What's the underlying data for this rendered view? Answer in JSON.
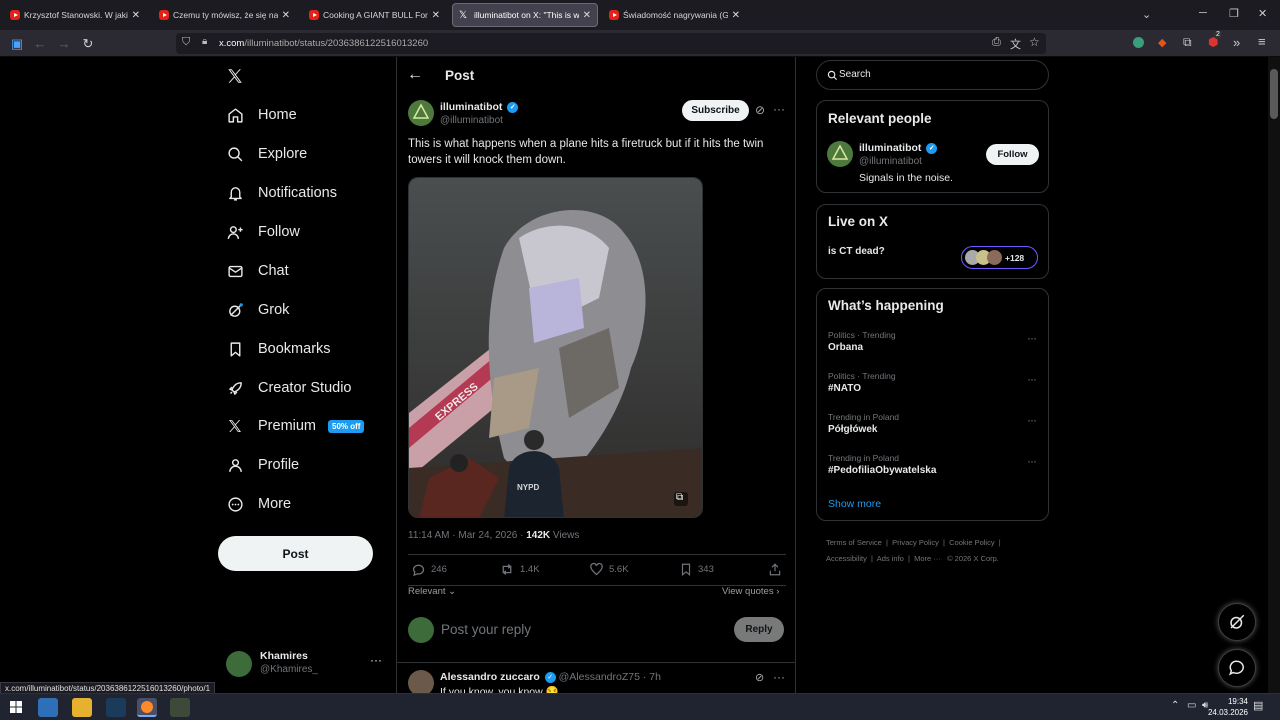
{
  "browser": {
    "tabs": [
      {
        "title": "Krzysztof Stanowski. W jakiej sy",
        "icon": "youtube-icon"
      },
      {
        "title": "Czemu ty mówisz, że się na cie",
        "icon": "youtube-icon"
      },
      {
        "title": "Cooking A GIANT BULL For A G",
        "icon": "youtube-icon"
      },
      {
        "title": "illuminatibot on X: \"This is what",
        "icon": "x-icon"
      },
      {
        "title": "Świadomość nagrywania (Giełd",
        "icon": "youtube-icon"
      }
    ],
    "url_host": "x.com",
    "url_path": "/illuminatibot/status/2036386122516013260",
    "status_url": "x.com/illuminatibot/status/2036386122516013260/photo/1",
    "extension_badge": "2"
  },
  "nav": {
    "items": [
      {
        "label": "Home",
        "icon": "home-icon"
      },
      {
        "label": "Explore",
        "icon": "search-icon"
      },
      {
        "label": "Notifications",
        "icon": "bell-icon"
      },
      {
        "label": "Follow",
        "icon": "person-plus-icon"
      },
      {
        "label": "Chat",
        "icon": "mail-icon"
      },
      {
        "label": "Grok",
        "icon": "grok-icon"
      },
      {
        "label": "Bookmarks",
        "icon": "bookmark-icon"
      },
      {
        "label": "Creator Studio",
        "icon": "rocket-icon"
      },
      {
        "label": "Premium",
        "icon": "x-logo-icon"
      },
      {
        "label": "Profile",
        "icon": "person-icon"
      },
      {
        "label": "More",
        "icon": "more-circle-icon"
      }
    ],
    "premium_badge": "50% off",
    "post_button": "Post",
    "account": {
      "name": "Khamires",
      "handle": "@Khamires_"
    }
  },
  "post": {
    "header_title": "Post",
    "author_name": "illuminatibot",
    "author_handle": "@illuminatibot",
    "subscribe_label": "Subscribe",
    "text": "This is what happens when a plane hits a firetruck but if it hits the twin towers it will knock them down.",
    "image_text": "EXPRESS",
    "image_patch": "NYPD",
    "time": "11:14 AM · Mar 24, 2026 · ",
    "views_count": "142K",
    "views_label": " Views",
    "stats": {
      "replies": "246",
      "reposts": "1.4K",
      "likes": "5.6K",
      "bookmarks": "343"
    },
    "sort_label": "Relevant",
    "view_quotes": "View quotes",
    "reply_placeholder": "Post your reply",
    "reply_button": "Reply",
    "reply_author": "Alessandro zuccaro",
    "reply_handle": "@AlessandroZ75 · 7h",
    "reply_text": "If you know, you know 😏"
  },
  "sidebar": {
    "search_placeholder": "Search",
    "relevant": {
      "title": "Relevant people",
      "name": "illuminatibot",
      "handle": "@illuminatibot",
      "bio": "Signals in the noise.",
      "follow": "Follow"
    },
    "live": {
      "title": "Live on X",
      "topic": "is CT dead?",
      "count": "+128"
    },
    "happening": {
      "title": "What’s happening",
      "trends": [
        {
          "meta": "Politics · Trending",
          "name": "Orbana"
        },
        {
          "meta": "Politics · Trending",
          "name": "#NATO"
        },
        {
          "meta": "Trending in Poland",
          "name": "Półgłówek"
        },
        {
          "meta": "Trending in Poland",
          "name": "#PedofiliaObywatelska"
        }
      ],
      "show_more": "Show more"
    },
    "footer": [
      "Terms of Service",
      "Privacy Policy",
      "Cookie Policy",
      "Accessibility",
      "Ads info",
      "More ···",
      "© 2026 X Corp."
    ]
  },
  "taskbar": {
    "time": "19:34",
    "date": "24.03.2026"
  },
  "colors": {
    "accent": "#1d9bf0",
    "background": "#000000",
    "border": "#2f3336",
    "muted": "#71767b"
  }
}
